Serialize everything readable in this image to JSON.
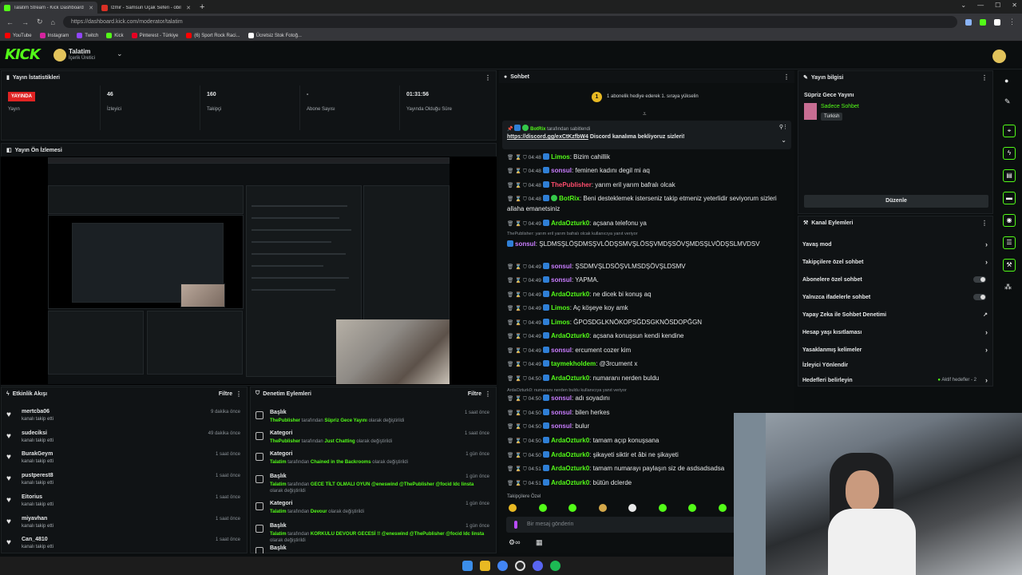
{
  "browser": {
    "tabs": [
      {
        "title": "Talatim Stream - Kick Dashboard",
        "color": "#53fc18"
      },
      {
        "title": "İzmir - Samsun Uçak Seferi - obil",
        "color": "#d93025"
      }
    ],
    "url": "https://dashboard.kick.com/moderator/talatim",
    "url_host": "dashboard.kick.com",
    "bookmarks": [
      "YouTube",
      "Instagram",
      "Twitch",
      "Kick",
      "Pinterest - Türkiye",
      "(6) Sport Rock Raci...",
      "Ücretsiz Stok Fotoğ..."
    ]
  },
  "header": {
    "logo": "KICK",
    "channel_name": "Talatim",
    "channel_role": "İçerik Üretici"
  },
  "stats": {
    "title": "Yayın İstatistikleri",
    "live_badge": "YAYINDA",
    "live_label": "Yayın",
    "viewers": "46",
    "viewers_label": "İzleyici",
    "followers": "160",
    "followers_label": "Takipçi",
    "subs": "-",
    "subs_label": "Abone Sayısı",
    "uptime": "01:31:56",
    "uptime_label": "Yayında Olduğu Süre"
  },
  "preview": {
    "title": "Yayın Ön İzlemesi"
  },
  "activity": {
    "title": "Etkinlik Akışı",
    "filter": "Filtre",
    "items": [
      {
        "name": "mertcba06",
        "sub": "kanalı takip etti",
        "time": "9 dakika önce"
      },
      {
        "name": "sudeciksi",
        "sub": "kanalı takip etti",
        "time": "49 dakika önce"
      },
      {
        "name": "BurakGeym",
        "sub": "kanalı takip etti",
        "time": "1 saat önce"
      },
      {
        "name": "pustperest8",
        "sub": "kanalı takip etti",
        "time": "1 saat önce"
      },
      {
        "name": "Eitorius",
        "sub": "kanalı takip etti",
        "time": "1 saat önce"
      },
      {
        "name": "miyavhan",
        "sub": "kanalı takip etti",
        "time": "1 saat önce"
      },
      {
        "name": "Can_4810",
        "sub": "kanalı takip etti",
        "time": "1 saat önce"
      }
    ]
  },
  "modlog": {
    "title": "Denetim Eylemleri",
    "filter": "Filtre",
    "items": [
      {
        "name": "Başlık",
        "who": "ThePublisher",
        "mid": " tarafından ",
        "val": "Süpriz Gece Yayını",
        "end": " olarak değiştirildi",
        "time": "1 saat önce"
      },
      {
        "name": "Kategori",
        "who": "ThePublisher",
        "mid": " tarafından ",
        "val": "Just Chatting",
        "end": " olarak değiştirildi",
        "time": "1 saat önce"
      },
      {
        "name": "Kategori",
        "who": "Talatim",
        "mid": " tarafından ",
        "val": "Chained in the Backrooms",
        "end": " olarak değiştirildi",
        "time": "1 gün önce"
      },
      {
        "name": "Başlık",
        "who": "Talatim",
        "mid": " tarafından ",
        "val": "GECE TİLT OLMALI OYUN @eneswind @ThePublisher @focid ldc linsta",
        "end": " olarak değiştirildi",
        "time": "1 gün önce"
      },
      {
        "name": "Kategori",
        "who": "Talatim",
        "mid": " tarafından ",
        "val": "Devour",
        "end": " olarak değiştirildi",
        "time": "1 gün önce"
      },
      {
        "name": "Başlık",
        "who": "Talatim",
        "mid": " tarafından ",
        "val": "KORKULU DEVOUR GECESİ !! @eneswind @ThePublisher @focid ldc linsta",
        "end": " olarak değiştirildi",
        "time": "1 gün önce"
      },
      {
        "name": "Başlık",
        "who": "",
        "mid": "",
        "val": "",
        "end": "",
        "time": ""
      }
    ]
  },
  "chat": {
    "title": "Sohbet",
    "gift_banner": "1 abonelik hediye ederek 1. sıraya yükselin",
    "gift_rank": "1",
    "pinned_by": "BotRix",
    "pinned_suffix": " tarafından sabitlendi",
    "pinned_link": "https://discord.gg/exCtKzfbW4",
    "pinned_text": " Discord kanalıma bekliyoruz sizleri!",
    "messages": [
      {
        "time": "04:48",
        "user": "Limos",
        "color": "#53fc18",
        "text": ": Bizim cahillik"
      },
      {
        "time": "04:48",
        "user": "sonsul",
        "color": "#c97dff",
        "text": ": feminen kadını degil mi aq"
      },
      {
        "time": "04:48",
        "user": "ThePublisher",
        "color": "#ff4d6d",
        "text": ": yarım eril yarım bafralı olcak"
      },
      {
        "time": "04:48",
        "user": "BotRix",
        "color": "#53fc18",
        "text": ": Beni desteklemek isterseniz takip etmeniz yeterlidir seviyorum sizleri allaha emanetsiniz"
      },
      {
        "time": "04:49",
        "user": "ArdaOzturk0",
        "color": "#53fc18",
        "text": ": açsana telefonu ya"
      },
      {
        "time": "",
        "user": "sonsul",
        "color": "#c97dff",
        "text": ": ŞLDMSŞLÖŞDMSŞVLÖDŞSMVŞLÖSŞVMDŞSÖVŞMDSŞLVÖDŞSLMVDSV"
      },
      {
        "time": "04:49",
        "user": "sonsul",
        "color": "#c97dff",
        "text": ": ŞSDMVŞLDSÖŞVLMSDŞÖVŞLDSMV"
      },
      {
        "time": "04:49",
        "user": "sonsul",
        "color": "#c97dff",
        "text": ": YAPMA."
      },
      {
        "time": "04:49",
        "user": "ArdaOzturk0",
        "color": "#53fc18",
        "text": ": ne dicek bi konuş aq"
      },
      {
        "time": "04:49",
        "user": "Limos",
        "color": "#53fc18",
        "text": ": Aç köşeye koy amk"
      },
      {
        "time": "04:49",
        "user": "Limos",
        "color": "#53fc18",
        "text": ": ĞPOSDGLKNÖKOPSĞDSGKNÖSDOPĞGN"
      },
      {
        "time": "04:49",
        "user": "ArdaOzturk0",
        "color": "#53fc18",
        "text": ": açsana konuşsun kendi kendine"
      },
      {
        "time": "04:49",
        "user": "sonsul",
        "color": "#c97dff",
        "text": ": ercument cozer kim"
      },
      {
        "time": "04:49",
        "user": "taymekholdem",
        "color": "#53fc18",
        "text": ": @3rcument x"
      },
      {
        "time": "04:50",
        "user": "ArdaOzturk0",
        "color": "#53fc18",
        "text": ": numaranı nerden buldu"
      },
      {
        "time": "04:50",
        "user": "sonsul",
        "color": "#c97dff",
        "text": ": adı soyadını"
      },
      {
        "time": "04:50",
        "user": "sonsul",
        "color": "#c97dff",
        "text": ": bilen herkes"
      },
      {
        "time": "04:50",
        "user": "sonsul",
        "color": "#c97dff",
        "text": ": bulur"
      },
      {
        "time": "04:50",
        "user": "ArdaOzturk0",
        "color": "#53fc18",
        "text": ": tamam açıp konuşsana"
      },
      {
        "time": "04:50",
        "user": "ArdaOzturk0",
        "color": "#53fc18",
        "text": ": şikayeti siktir et âbi ne şikayeti"
      },
      {
        "time": "04:51",
        "user": "ArdaOzturk0",
        "color": "#53fc18",
        "text": ": tamam numarayı paylaşın siz de asdsadsadsa"
      },
      {
        "time": "04:51",
        "user": "ArdaOzturk0",
        "color": "#53fc18",
        "text": ": bütün dclerde"
      }
    ],
    "reply1": "ThePublisher: yarım eril yarım bafralı olcak kullanıcıya yanıt veriyor",
    "reply2": "ArdaOzturk0: numaranı nerden buldu kullanıcıya yanıt veriyor",
    "followers_only": "Takipçilere Özel",
    "input_placeholder": "Bir mesaj gönderin"
  },
  "streaminfo": {
    "title": "Yayın bilgisi",
    "stream_title": "Süpriz Gece Yayını",
    "category": "Sadece Sohbet",
    "lang": "Turkish",
    "edit": "Düzenle"
  },
  "channelactions": {
    "title": "Kanal Eylemleri",
    "items": [
      "Yavaş mod",
      "Takipçilere özel sohbet",
      "Abonelere özel sohbet",
      "Yalnızca ifadelerle sohbet",
      "Yapay Zeka ile Sohbet Denetimi",
      "Hesap yaşı kısıtlaması",
      "Yasaklanmış kelimeler",
      "İzleyici Yönlendir",
      "Hedefleri belirleyin"
    ],
    "goals_status": "Aktif hedefler - 2"
  }
}
